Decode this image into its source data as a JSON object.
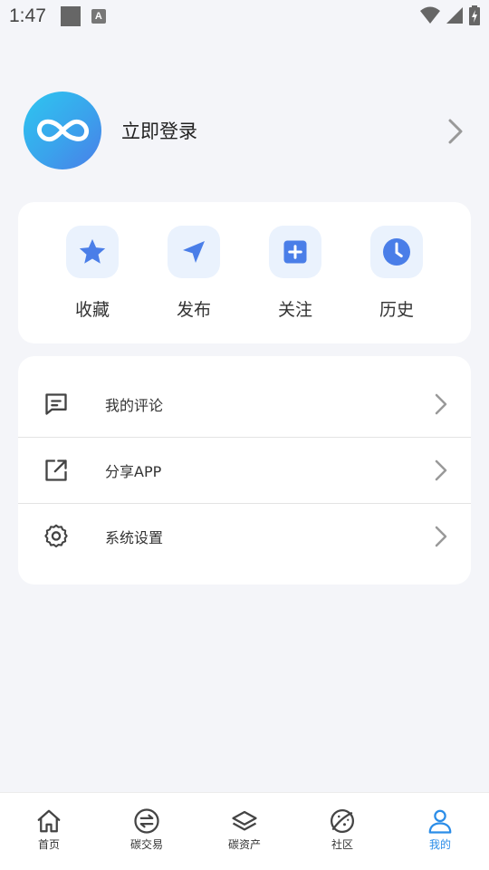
{
  "statusbar": {
    "time": "1:47",
    "a_label": "A"
  },
  "profile": {
    "login_label": "立即登录"
  },
  "quick_actions": [
    {
      "label": "收藏",
      "icon": "star-icon"
    },
    {
      "label": "发布",
      "icon": "send-icon"
    },
    {
      "label": "关注",
      "icon": "plus-square-icon"
    },
    {
      "label": "历史",
      "icon": "clock-icon"
    }
  ],
  "menu": [
    {
      "label": "我的评论",
      "icon": "comment-icon"
    },
    {
      "label": "分享APP",
      "icon": "share-icon"
    },
    {
      "label": "系统设置",
      "icon": "gear-icon"
    }
  ],
  "tabs": [
    {
      "label": "首页",
      "icon": "home-icon"
    },
    {
      "label": "碳交易",
      "icon": "exchange-icon"
    },
    {
      "label": "碳资产",
      "icon": "layers-icon"
    },
    {
      "label": "社区",
      "icon": "planet-icon"
    },
    {
      "label": "我的",
      "icon": "user-icon",
      "active": true
    }
  ],
  "colors": {
    "accent": "#4a7ee8",
    "tab_active": "#2b8de8",
    "background": "#f4f5f9"
  }
}
